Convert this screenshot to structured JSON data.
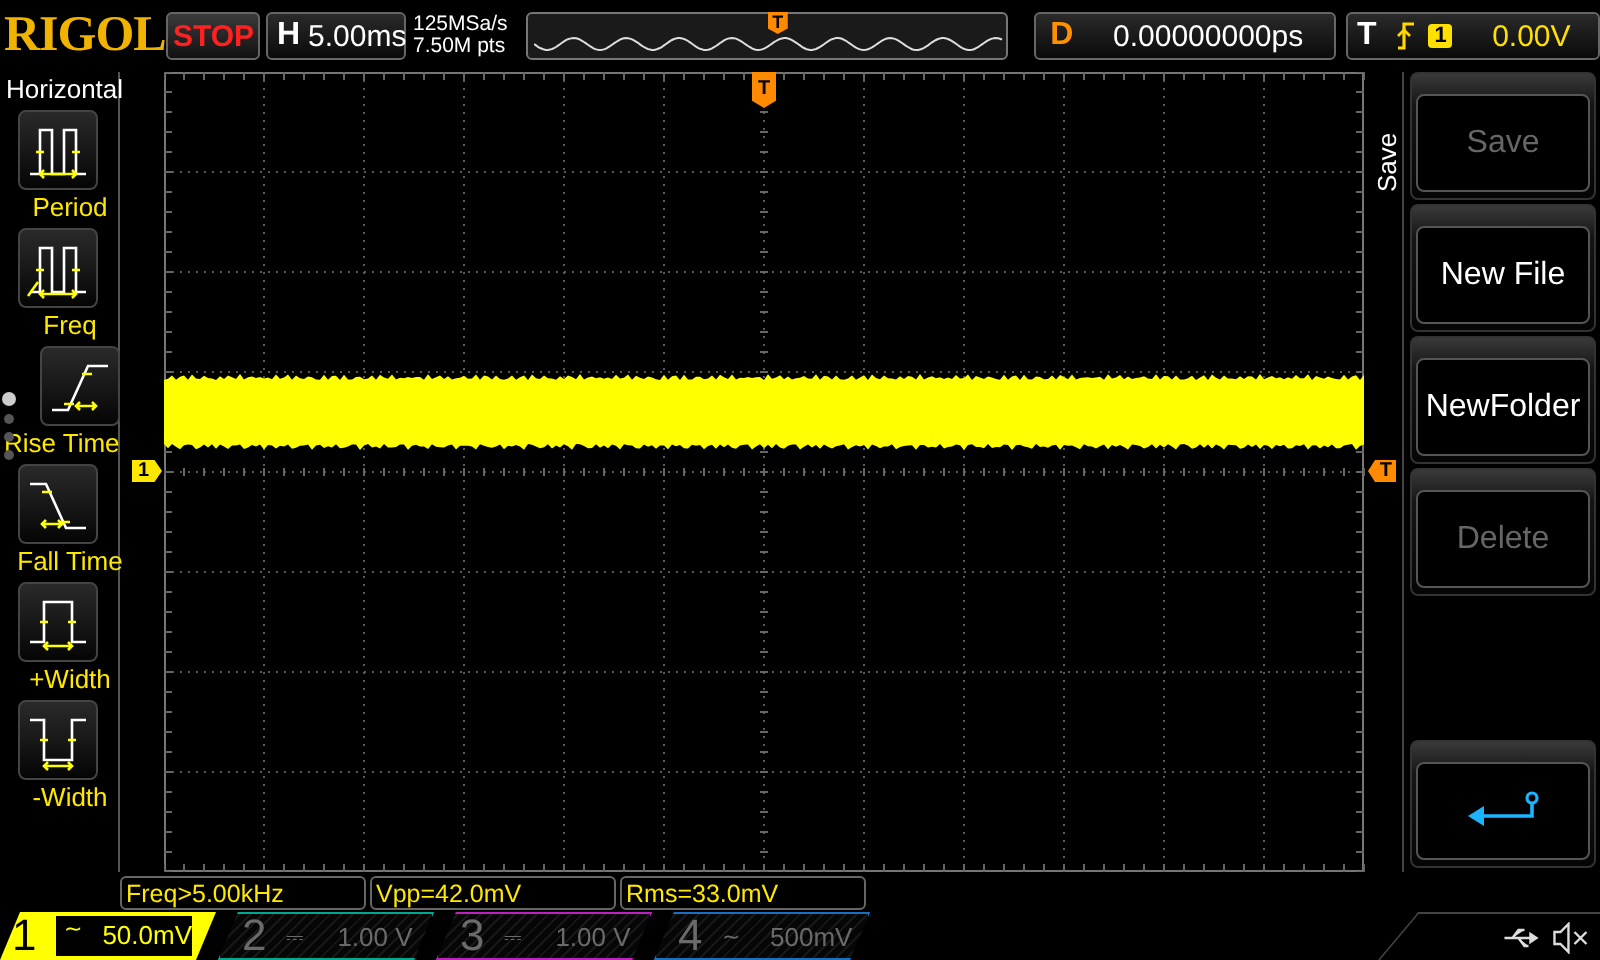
{
  "brand": "RIGOL",
  "run_state": "STOP",
  "horizontal": {
    "label": "H",
    "timebase": "5.00ms",
    "sample_rate": "125MSa/s",
    "memory_depth": "7.50M pts"
  },
  "overview": {
    "trigger_marker": "T"
  },
  "delay": {
    "label": "D",
    "value": "0.00000000ps"
  },
  "trigger": {
    "label": "T",
    "source": "1",
    "level": "0.00V"
  },
  "measure_menu": {
    "title": "Horizontal",
    "items": [
      {
        "label": "Period",
        "kind": "period"
      },
      {
        "label": "Freq",
        "kind": "freq"
      },
      {
        "label": "Rise Time",
        "kind": "rise"
      },
      {
        "label": "Fall Time",
        "kind": "fall"
      },
      {
        "label": "+Width",
        "kind": "pwidth"
      },
      {
        "label": "-Width",
        "kind": "nwidth"
      }
    ],
    "page_dots": [
      {
        "selected": true
      },
      {
        "selected": false
      },
      {
        "selected": false
      },
      {
        "selected": false
      }
    ]
  },
  "grid": {
    "trigger_position_marker": "T",
    "channel_marker": "1",
    "trigger_level_marker": "T"
  },
  "soft_menu": {
    "title": "Save",
    "buttons": [
      {
        "kind": "text",
        "label": "Save",
        "disabled": true
      },
      {
        "kind": "text",
        "label": "New File",
        "disabled": false
      },
      {
        "kind": "text",
        "label": "NewFolder",
        "disabled": false
      },
      {
        "kind": "text",
        "label": "Delete",
        "disabled": true
      },
      {
        "kind": "back"
      }
    ]
  },
  "measurements": [
    "Freq>5.00kHz",
    "Vpp=42.0mV",
    "Rms=33.0mV"
  ],
  "channels": [
    {
      "number": "1",
      "coupling": "~",
      "scale": "50.0mV",
      "on": true,
      "color": "#ffff00"
    },
    {
      "number": "2",
      "coupling": "⎓",
      "scale": "1.00 V",
      "on": false,
      "color": "#00a890"
    },
    {
      "number": "3",
      "coupling": "⎓",
      "scale": "1.00 V",
      "on": false,
      "color": "#c020c0"
    },
    {
      "number": "4",
      "coupling": "~",
      "scale": "500mV",
      "on": false,
      "color": "#1a70c0"
    }
  ]
}
